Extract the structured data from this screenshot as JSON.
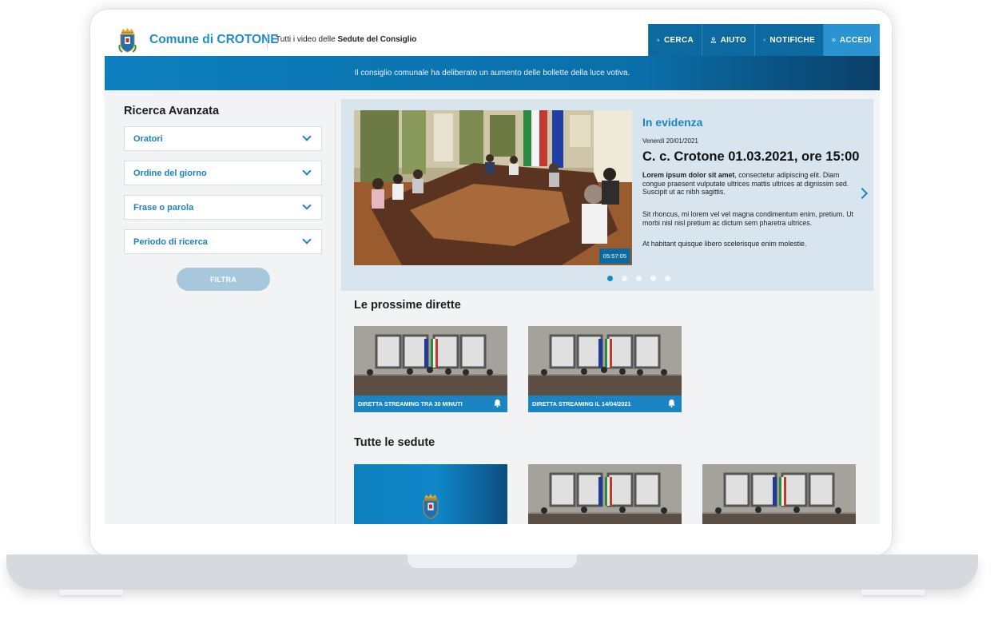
{
  "header": {
    "site_title": "Comune di CROTONE",
    "subtitle_prefix": "Tutti i video delle ",
    "subtitle_bold": "Sedute del Consiglio",
    "nav": [
      {
        "label": "CERCA",
        "icon": "search-icon"
      },
      {
        "label": "AIUTO",
        "icon": "help-icon"
      },
      {
        "label": "NOTIFICHE",
        "icon": "bell-icon"
      },
      {
        "label": "ACCEDI",
        "icon": "login-icon"
      }
    ]
  },
  "announcement": "Il consiglio comunale ha deliberato un aumento delle bollette della luce votiva.",
  "sidebar": {
    "title": "Ricerca Avanzata",
    "filters": [
      "Oratori",
      "Ordine del giorno",
      "Frase o parola",
      "Periodo di ricerca"
    ],
    "button": "FILTRA"
  },
  "featured": {
    "kicker": "In evidenza",
    "date": "Venerdì 20/01/2021",
    "title": "C. c. Crotone 01.03.2021, ore 15:00",
    "p1_bold": "Lorem ipsum dolor sit amet",
    "p1_rest": ", consectetur adipiscing elit. Diam congue praesent vulputate ultrices mattis ultrices at dignissim sed. Suscipit ut ac nibh sagittis.",
    "p2": "Sit rhoncus, mi lorem vel vel magna condimentum enim, pretium. Ut morbi nisl nisl pretium ac dictum sem pharetra ultrices.",
    "p3": "At habitant quisque libero scelerisque enim molestie.",
    "duration": "05:57:05",
    "slides": 5,
    "active_slide": 1
  },
  "upcoming": {
    "title": "Le prossime dirette",
    "items": [
      {
        "label": "DIRETTA STREAMING TRA 30 MINUTI"
      },
      {
        "label": "DIRETTA STREAMING IL 14/04/2021"
      }
    ]
  },
  "all_sessions": {
    "title": "Tutte le sedute"
  },
  "colors": {
    "primary": "#1b85c4",
    "nav_dark": "#0c6aa1",
    "nav_accent": "#2a93d2"
  }
}
